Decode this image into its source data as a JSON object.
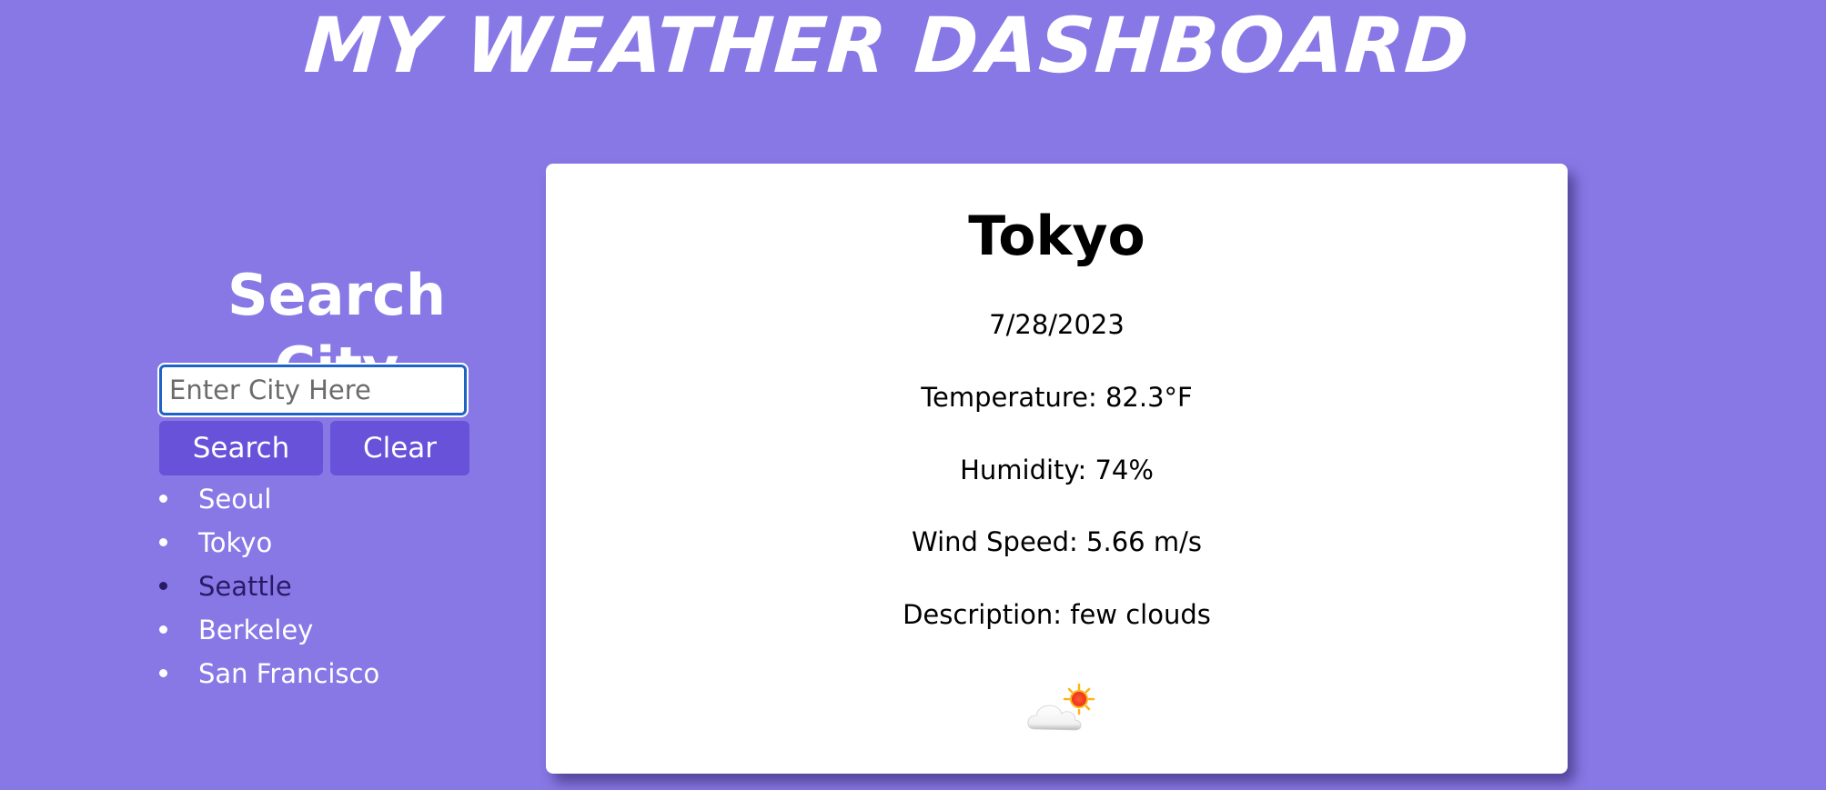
{
  "header": {
    "title": "My Weather Dashboard"
  },
  "search": {
    "heading": "Search City",
    "placeholder": "Enter City Here",
    "search_label": "Search",
    "clear_label": "Clear"
  },
  "history": {
    "items": [
      {
        "label": "Seoul",
        "visited": false
      },
      {
        "label": "Tokyo",
        "visited": false
      },
      {
        "label": "Seattle",
        "visited": true
      },
      {
        "label": "Berkeley",
        "visited": false
      },
      {
        "label": "San Francisco",
        "visited": false
      }
    ]
  },
  "weather": {
    "city": "Tokyo",
    "date": "7/28/2023",
    "temperature": "Temperature: 82.3°F",
    "humidity": "Humidity: 74%",
    "wind": "Wind Speed: 5.66 m/s",
    "description": "Description: few clouds",
    "icon": "few-clouds-day-icon"
  },
  "colors": {
    "background": "#8878e6",
    "button": "#6752d9",
    "card": "#ffffff",
    "visited_link": "#2a1a66"
  }
}
